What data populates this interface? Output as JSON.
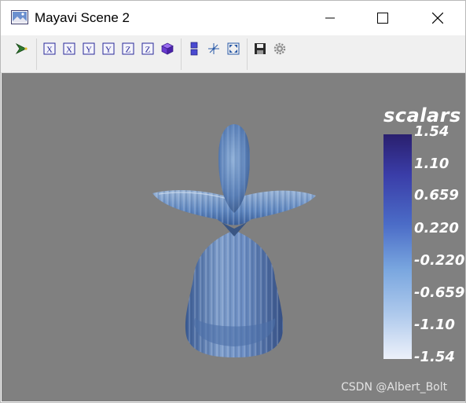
{
  "window": {
    "title": "Mayavi Scene 2",
    "icon": "mayavi-scene-icon"
  },
  "title_buttons": [
    "minimize-icon",
    "maximize-icon",
    "close-icon"
  ],
  "toolbar": {
    "buttons": [
      {
        "icon": "mayavi-pipeline-icon"
      },
      {
        "icon": "view-x-plus-icon",
        "label": "X"
      },
      {
        "icon": "view-x-minus-icon",
        "label": "X"
      },
      {
        "icon": "view-y-plus-icon",
        "label": "Y"
      },
      {
        "icon": "view-y-minus-icon",
        "label": "Y"
      },
      {
        "icon": "view-z-plus-icon",
        "label": "Z"
      },
      {
        "icon": "view-z-minus-icon",
        "label": "Z"
      },
      {
        "icon": "isometric-view-icon"
      },
      {
        "icon": "parallel-projection-icon"
      },
      {
        "icon": "axes-indicator-icon"
      },
      {
        "icon": "fullscreen-icon"
      },
      {
        "icon": "save-icon"
      },
      {
        "icon": "settings-icon"
      }
    ]
  },
  "colorbar": {
    "title": "scalars",
    "labels": [
      "1.54",
      "1.10",
      "0.659",
      "0.220",
      "-0.220",
      "-0.659",
      "-1.10",
      "-1.54"
    ],
    "colors": {
      "top": "#2a1f6e",
      "mid": "#4b6cc7",
      "bottom": "#edf1fa"
    }
  },
  "scene": {
    "background": "#808080",
    "object_color": "#5f87c0"
  },
  "watermark": "CSDN @Albert_Bolt"
}
